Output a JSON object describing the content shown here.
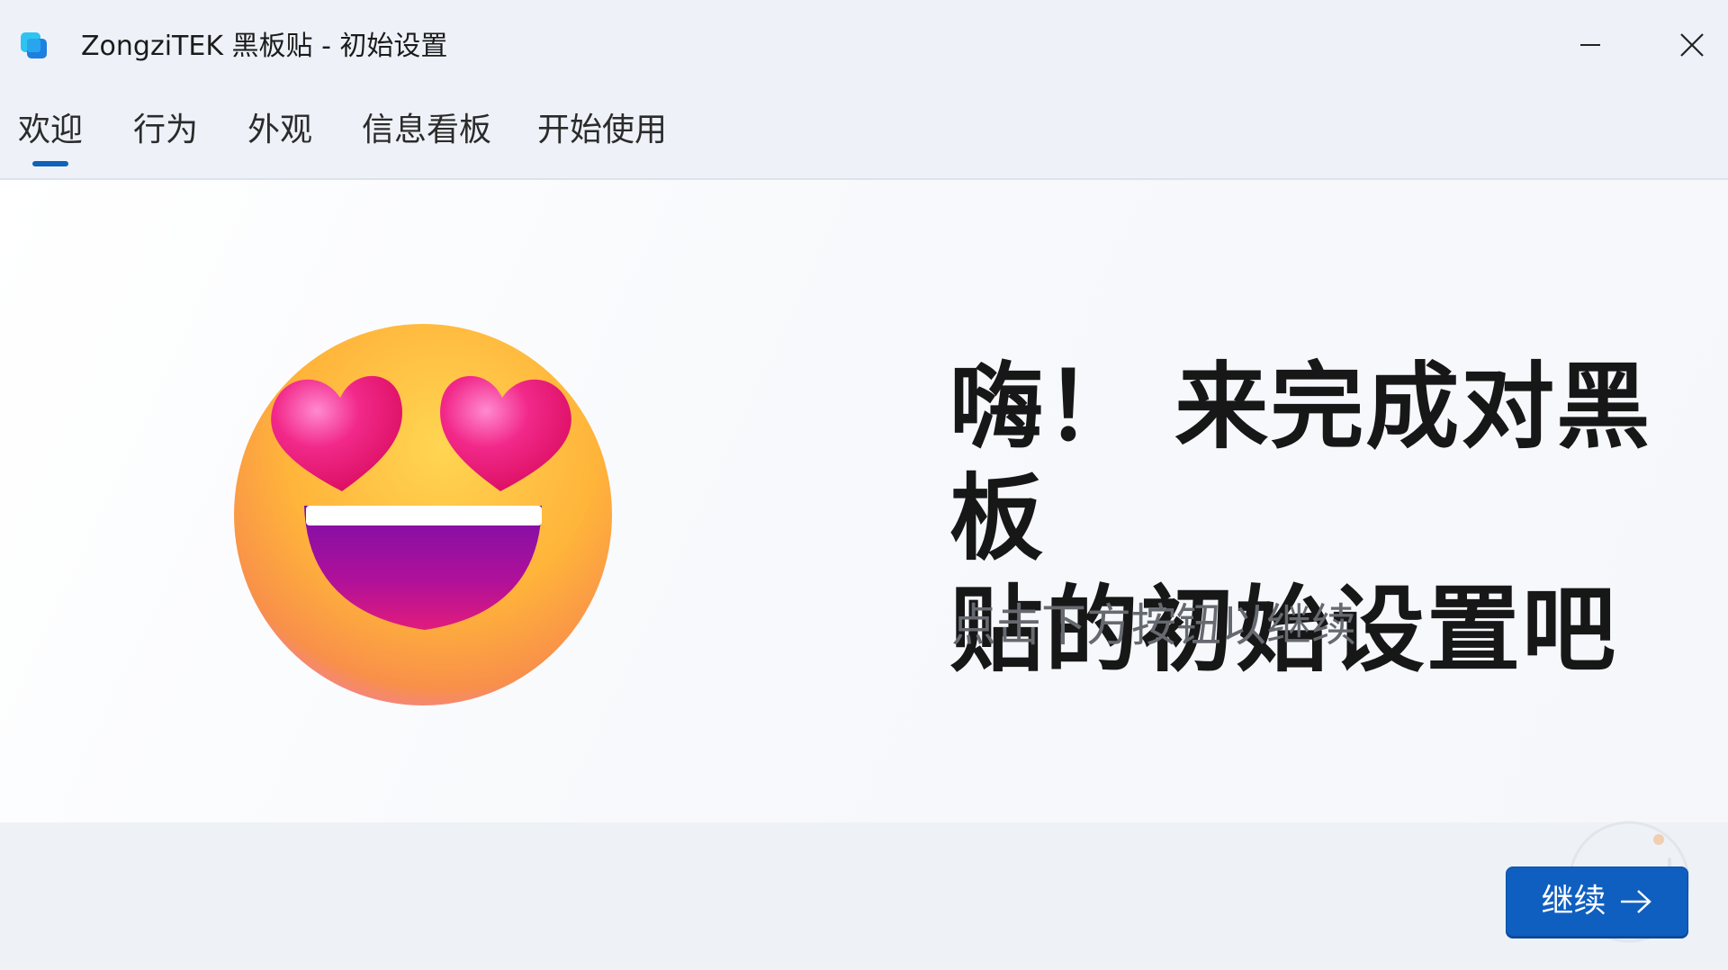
{
  "window": {
    "title": "ZongziTEK 黑板贴 - 初始设置",
    "icon": "app-icon",
    "minimize_icon": "minimize-icon",
    "close_icon": "close-icon"
  },
  "tabs": [
    {
      "label": "欢迎",
      "selected": true
    },
    {
      "label": "行为",
      "selected": false
    },
    {
      "label": "外观",
      "selected": false
    },
    {
      "label": "信息看板",
      "selected": false
    },
    {
      "label": "开始使用",
      "selected": false
    }
  ],
  "welcome": {
    "emoji_icon": "heart-eyes-emoji",
    "headline_line1": "嗨！ 来完成对黑板",
    "headline_line2": "贴的初始设置吧",
    "subtitle": "点击下方按钮以继续"
  },
  "footer": {
    "continue_label": "继续",
    "continue_icon": "arrow-right-icon"
  },
  "colors": {
    "accent": "#0f5fc0",
    "tab_indicator": "#0f62b8",
    "window_background": "#eef2f8",
    "content_background": "#f7f9fc"
  }
}
